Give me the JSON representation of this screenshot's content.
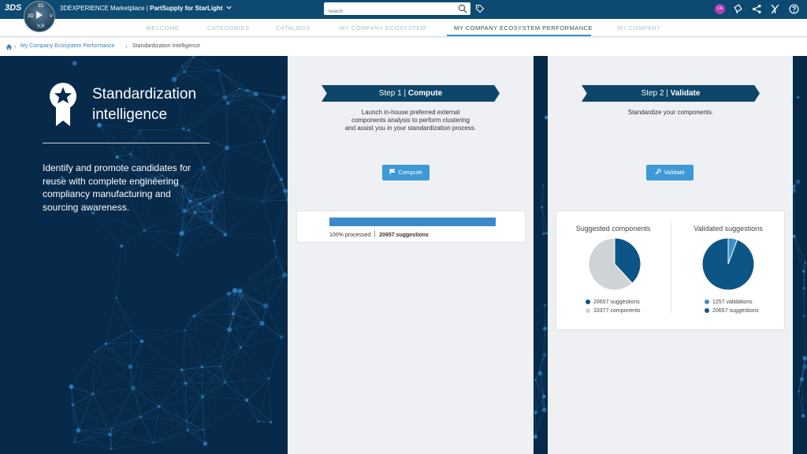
{
  "header": {
    "logo": "3DS",
    "compass": {
      "top_label": "3D",
      "left_label": "3D",
      "right_label": "V",
      "bottom_label": "V,R"
    },
    "app_prefix": "3DEXPERIENCE Marketplace | ",
    "app_name": "PartSupply for StarLight",
    "search": {
      "placeholder": "Search"
    },
    "user_initials": "CA",
    "icons": [
      "tag-icon",
      "notification-icon",
      "share-icon",
      "community-icon",
      "help-icon"
    ]
  },
  "nav": {
    "items": [
      {
        "label": "WELCOME"
      },
      {
        "label": "CATEGORIES"
      },
      {
        "label": "CATALOGS"
      },
      {
        "label": "MY COMPANY ECOSYSTEM"
      },
      {
        "label": "MY COMPANY ECOSYSTEM PERFORMANCE",
        "active": true
      },
      {
        "label": "MY COMPANY"
      }
    ]
  },
  "breadcrumb": {
    "items": [
      "My Company Ecosystem Performance",
      "Standardization Intelligence"
    ]
  },
  "hero": {
    "title_line1": "Standardization",
    "title_line2": "intelligence",
    "description": "Identify and promote candidates for reuse with complete engineering compliancy manufacturing and sourcing awareness."
  },
  "step1": {
    "label_prefix": "Step 1 | ",
    "label_bold": "Compute",
    "description_line1": "Launch in-house preferred external",
    "description_line2": "components analysis to perform clustering",
    "description_line3": "and assist you in your standardization process.",
    "button_label": "Compute",
    "progress_percent": 100,
    "progress_text": "100% processed",
    "suggestions_text": "20657 suggestions"
  },
  "step2": {
    "label_prefix": "Step 2 | ",
    "label_bold": "Validate",
    "description": "Standardize your components.",
    "button_label": "Validate"
  },
  "colors": {
    "dark_blue": "#0c4a72",
    "accent_blue": "#3e9ad6",
    "pie_dark": "#0d5586",
    "pie_light": "#cfd3d6",
    "pie_mid": "#3a92c8"
  },
  "chart_data": [
    {
      "type": "pie",
      "title": "Suggested components",
      "categories": [
        "suggestions",
        "components"
      ],
      "values": [
        20657,
        33377
      ],
      "legend": [
        "20657 suggestions",
        "33377 components"
      ],
      "colors": [
        "#0d5586",
        "#cfd3d6"
      ]
    },
    {
      "type": "pie",
      "title": "Validated suggestions",
      "categories": [
        "validations",
        "suggestions"
      ],
      "values": [
        1257,
        20657
      ],
      "legend": [
        "1257 validations",
        "20657 suggestions"
      ],
      "colors": [
        "#3a92c8",
        "#0d5586"
      ]
    }
  ]
}
